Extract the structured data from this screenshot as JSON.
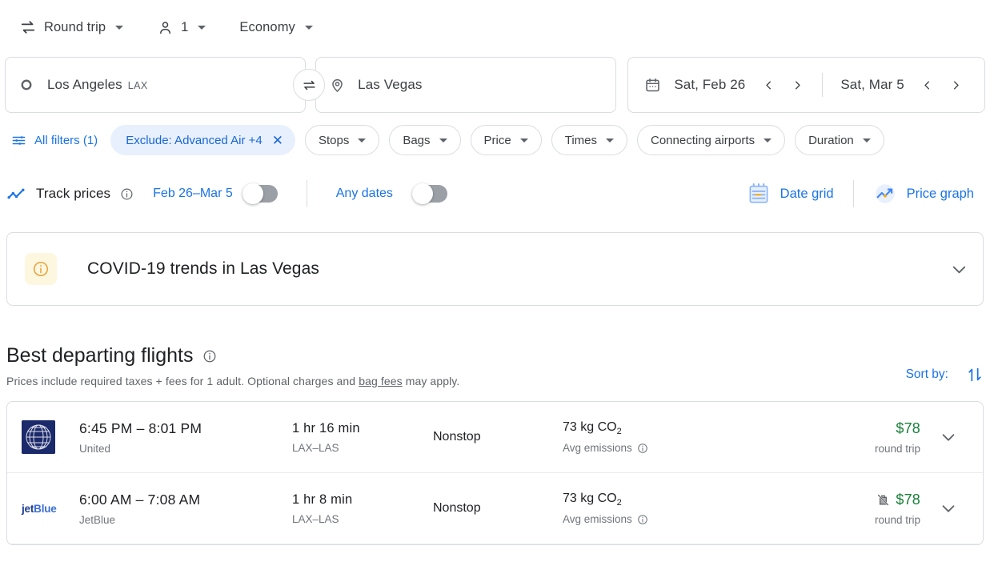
{
  "trip_controls": {
    "trip_type": {
      "label": "Round trip",
      "icon": "swap-horizontal-icon"
    },
    "passengers": {
      "label": "1",
      "icon": "person-icon"
    },
    "cabin_class": {
      "label": "Economy"
    }
  },
  "search": {
    "origin": {
      "city": "Los Angeles",
      "code": "LAX",
      "icon": "circle-origin-icon"
    },
    "destination": {
      "city": "Las Vegas",
      "code": "",
      "icon": "location-pin-icon"
    },
    "swap_icon": "swap-arrows-icon",
    "depart_date": "Sat, Feb 26",
    "return_date": "Sat, Mar 5",
    "calendar_icon": "calendar-icon"
  },
  "filters": {
    "all_filters_label": "All filters (1)",
    "active_chip": {
      "label": "Exclude: Advanced Air +4",
      "close": "✕"
    },
    "chips": [
      {
        "label": "Stops"
      },
      {
        "label": "Bags"
      },
      {
        "label": "Price"
      },
      {
        "label": "Times"
      },
      {
        "label": "Connecting airports"
      },
      {
        "label": "Duration"
      }
    ]
  },
  "track": {
    "title": "Track prices",
    "date_range_label": "Feb 26–Mar 5",
    "any_dates_label": "Any dates",
    "date_range_toggle": "off",
    "any_dates_toggle": "off",
    "date_grid_label": "Date grid",
    "price_graph_label": "Price graph"
  },
  "covid": {
    "title": "COVID-19 trends in Las Vegas",
    "icon": "info-circle-icon",
    "expand_icon": "chevron-down-icon",
    "badge_color": "#fef7e0",
    "icon_color": "#e8a33d"
  },
  "best": {
    "title": "Best departing flights",
    "subtitle_pre": "Prices include required taxes + fees for 1 adult. Optional charges and ",
    "subtitle_link": "bag fees",
    "subtitle_post": " may apply.",
    "sort_label": "Sort by:",
    "sort_icon": "sort-arrows-icon"
  },
  "flights": [
    {
      "airline": "United",
      "logo": "united-logo",
      "times": "6:45 PM – 8:01 PM",
      "duration": "1 hr 16 min",
      "route": "LAX–LAS",
      "stops": "Nonstop",
      "emissions": "73 kg CO",
      "emissions_sub_num": "2",
      "emissions_label": "Avg emissions",
      "price": "$78",
      "price_sub": "round trip",
      "no_bag_icon": false
    },
    {
      "airline": "JetBlue",
      "logo": "jetblue-logo",
      "times": "6:00 AM – 7:08 AM",
      "duration": "1 hr 8 min",
      "route": "LAX–LAS",
      "stops": "Nonstop",
      "emissions": "73 kg CO",
      "emissions_sub_num": "2",
      "emissions_label": "Avg emissions",
      "price": "$78",
      "price_sub": "round trip",
      "no_bag_icon": true
    }
  ],
  "colors": {
    "accent_blue": "#1a73e8",
    "chip_active_bg": "#e8f0fe",
    "price_green": "#188038",
    "border": "#dadce0"
  }
}
